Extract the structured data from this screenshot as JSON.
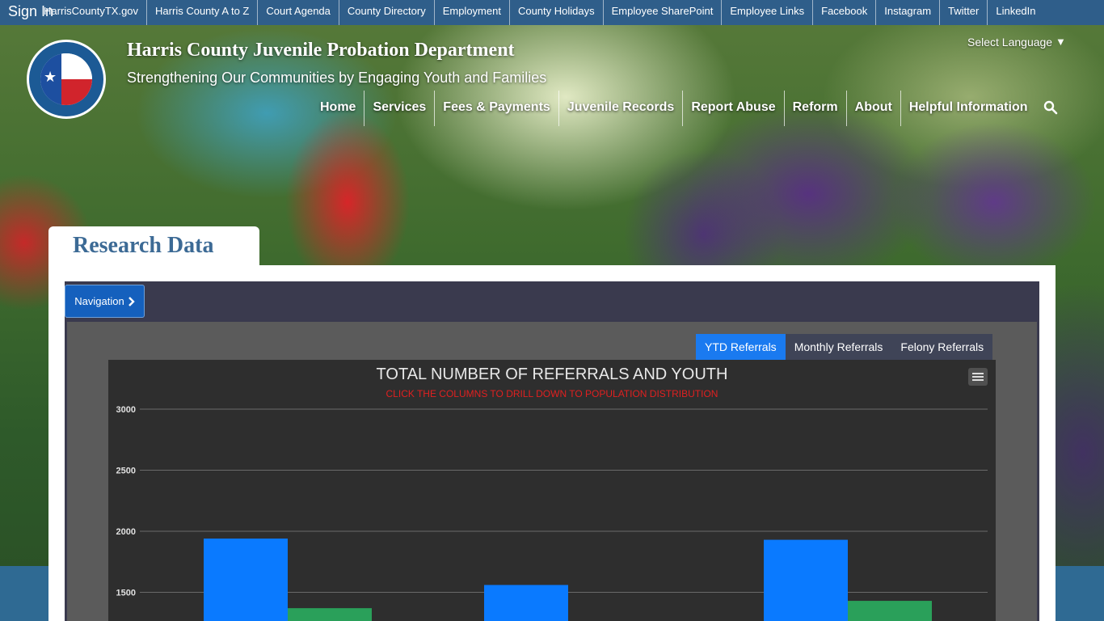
{
  "topbar": {
    "signin": "Sign In",
    "links": [
      "HarrisCountyTX.gov",
      "Harris County A to Z",
      "Court Agenda",
      "County Directory",
      "Employment",
      "County Holidays",
      "Employee SharePoint",
      "Employee Links",
      "Facebook",
      "Instagram",
      "Twitter",
      "LinkedIn"
    ]
  },
  "header": {
    "title": "Harris County Juvenile Probation Department",
    "tagline": "Strengthening Our Communities by Engaging Youth and Families",
    "language": "Select Language",
    "nav": [
      "Home",
      "Services",
      "Fees & Payments",
      "Juvenile Records",
      "Report Abuse",
      "Reform",
      "About",
      "Helpful Information"
    ]
  },
  "page": {
    "title": "Research Data",
    "navigation_button": "Navigation"
  },
  "tabs": [
    "YTD Referrals",
    "Monthly Referrals",
    "Felony Referrals"
  ],
  "colors": {
    "accent": "#1a7af0",
    "series1": "#0a7aff",
    "series2": "#2aa05a"
  },
  "chart_data": {
    "type": "bar",
    "title": "TOTAL NUMBER OF REFERRALS AND YOUTH",
    "subtitle": "CLICK THE COLUMNS TO DRILL DOWN TO POPULATION DISTRIBUTION",
    "yticks": [
      3000,
      2500,
      2000,
      1500
    ],
    "ylim": [
      1100,
      3000
    ],
    "series": [
      {
        "values": [
          1940,
          1560,
          1930
        ]
      },
      {
        "values": [
          1370,
          null,
          1430
        ]
      }
    ]
  }
}
